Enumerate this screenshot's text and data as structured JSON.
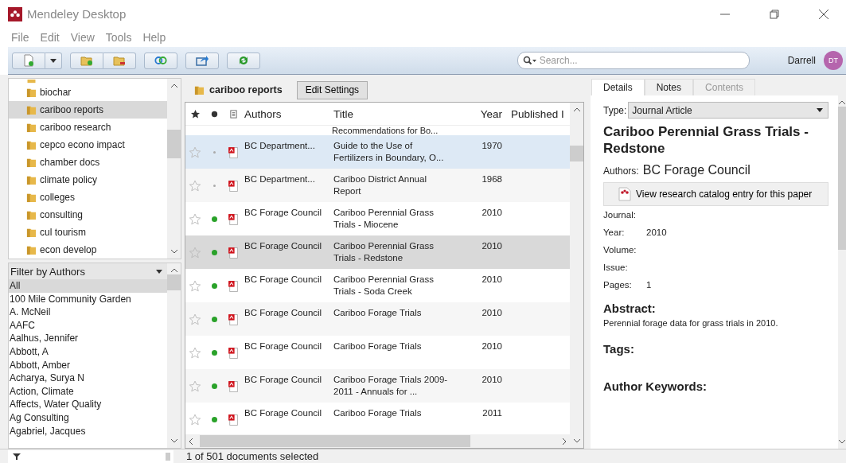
{
  "window": {
    "title": "Mendeley Desktop"
  },
  "menu": [
    "File",
    "Edit",
    "View",
    "Tools",
    "Help"
  ],
  "search": {
    "placeholder": "Search..."
  },
  "user": {
    "name": "Darrell",
    "initials": "DT"
  },
  "folders": [
    {
      "label": "biochar",
      "selected": false
    },
    {
      "label": "cariboo reports",
      "selected": true
    },
    {
      "label": "cariboo research",
      "selected": false
    },
    {
      "label": "cepco econo impact",
      "selected": false
    },
    {
      "label": "chamber docs",
      "selected": false
    },
    {
      "label": "climate policy",
      "selected": false
    },
    {
      "label": "colleges",
      "selected": false
    },
    {
      "label": "consulting",
      "selected": false
    },
    {
      "label": "cul tourism",
      "selected": false
    },
    {
      "label": "econ develop",
      "selected": false
    }
  ],
  "filter": {
    "label": "Filter by Authors",
    "items": [
      {
        "label": "All",
        "selected": true
      },
      {
        "label": "100 Mile Community Garden",
        "selected": false
      },
      {
        "label": "A. McNeil",
        "selected": false
      },
      {
        "label": "AAFC",
        "selected": false
      },
      {
        "label": "Aalhus, Jennifer",
        "selected": false
      },
      {
        "label": "Abbott, A",
        "selected": false
      },
      {
        "label": "Abbott, Amber",
        "selected": false
      },
      {
        "label": "Acharya, Surya N",
        "selected": false
      },
      {
        "label": "Action, Climate",
        "selected": false
      },
      {
        "label": "Affects, Water Quality",
        "selected": false
      },
      {
        "label": "Ag Consulting",
        "selected": false
      },
      {
        "label": "Agabriel, Jacques",
        "selected": false
      }
    ]
  },
  "collection": {
    "title": "cariboo reports",
    "button": "Edit Settings"
  },
  "table": {
    "columns": [
      "Authors",
      "Title",
      "Year",
      "Published I"
    ],
    "partial_title": "Recommendations for Bo...",
    "rows": [
      {
        "authors": "BC Department...",
        "title": "Guide to the Use of Fertilizers in Boundary, O...",
        "year": "1970",
        "read": false,
        "hovered": true,
        "selected": false
      },
      {
        "authors": "BC Department...",
        "title": "Cariboo District Annual Report",
        "year": "1968",
        "read": false,
        "hovered": false,
        "selected": false
      },
      {
        "authors": "BC Forage Council",
        "title": "Cariboo Perennial Grass Trials - Miocene",
        "year": "2010",
        "read": true,
        "hovered": false,
        "selected": false
      },
      {
        "authors": "BC Forage Council",
        "title": "Cariboo Perennial Grass Trials - Redstone",
        "year": "2010",
        "read": true,
        "hovered": false,
        "selected": true
      },
      {
        "authors": "BC Forage Council",
        "title": "Cariboo Perennial Grass Trials - Soda Creek",
        "year": "2010",
        "read": true,
        "hovered": false,
        "selected": false
      },
      {
        "authors": "BC Forage Council",
        "title": "Cariboo Forage Trials",
        "year": "2010",
        "read": true,
        "hovered": false,
        "selected": false
      },
      {
        "authors": "BC Forage Council",
        "title": "Cariboo Forage Trials",
        "year": "2010",
        "read": true,
        "hovered": false,
        "selected": false
      },
      {
        "authors": "BC Forage Council",
        "title": "Cariboo Forage Trials 2009-2011 - Annuals for ...",
        "year": "2010",
        "read": true,
        "hovered": false,
        "selected": false
      },
      {
        "authors": "BC Forage Council",
        "title": "Cariboo Forage Trials",
        "year": "2011",
        "read": true,
        "hovered": false,
        "selected": false
      }
    ]
  },
  "details": {
    "tabs": [
      {
        "label": "Details",
        "selected": true,
        "disabled": false
      },
      {
        "label": "Notes",
        "selected": false,
        "disabled": false
      },
      {
        "label": "Contents",
        "selected": false,
        "disabled": true
      }
    ],
    "type_label": "Type:",
    "type_value": "Journal Article",
    "title": "Cariboo Perennial Grass Trials - Redstone",
    "authors_label": "Authors:",
    "authors": "BC Forage Council",
    "catalog_button": "View research catalog entry for this paper",
    "fields": [
      {
        "label": "Journal:"
      },
      {
        "label": "Year:",
        "value": "2010"
      },
      {
        "label": "Volume:"
      },
      {
        "label": "Issue:"
      },
      {
        "label": "Pages:",
        "value": "1"
      }
    ],
    "abstract_heading": "Abstract:",
    "abstract": "Perennial forage data for grass trials in 2010.",
    "tags_heading": "Tags:",
    "keywords_heading": "Author Keywords:"
  },
  "status_bar": "1 of 501 documents selected"
}
